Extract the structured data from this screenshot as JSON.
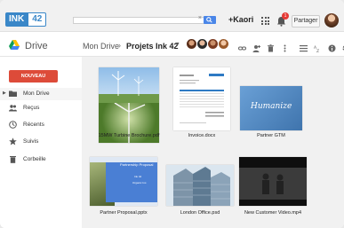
{
  "topbar": {
    "logo_part1": "INK",
    "logo_part2": "42",
    "search_clear": "×",
    "user_name": "+Kaori",
    "notification_count": "1",
    "share_label": "Partager"
  },
  "header": {
    "app_title": "Drive",
    "breadcrumb_root": "Mon Drive",
    "breadcrumb_sep": "›",
    "breadcrumb_current": "Projets Ink 42",
    "dropdown_caret": "▼"
  },
  "sidebar": {
    "new_button": "NOUVEAU",
    "items": [
      {
        "label": "Mon Drive",
        "icon": "folder-icon"
      },
      {
        "label": "Reçus",
        "icon": "people-icon"
      },
      {
        "label": "Récents",
        "icon": "clock-icon"
      },
      {
        "label": "Suivis",
        "icon": "star-icon"
      },
      {
        "label": "Corbeille",
        "icon": "trash-icon"
      }
    ]
  },
  "files": [
    {
      "name": "15MW Turbine Brochure.pdf"
    },
    {
      "name": "Invoice.docx"
    },
    {
      "name": "Partner GTM",
      "thumb_text": "Humanize"
    },
    {
      "name": "Partner Proposal.pptx",
      "thumb_title": "Partnership Proposal",
      "thumb_line1": "Ink 42",
      "thumb_line2": "Organic Inc."
    },
    {
      "name": "London Office.psd"
    },
    {
      "name": "New Customer Video.mp4"
    }
  ],
  "colors": {
    "accent_blue": "#4a86e8",
    "new_button_red": "#dd4b39",
    "logo_blue": "#3a87c8"
  }
}
